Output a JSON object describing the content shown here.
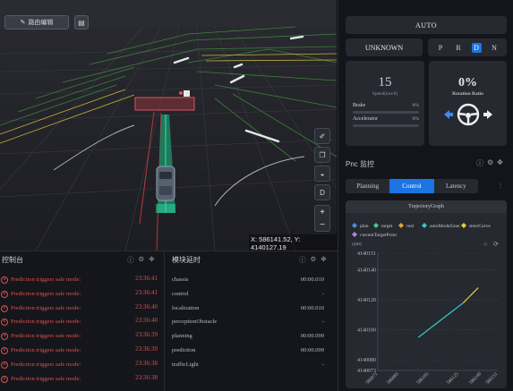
{
  "scene": {
    "route_edit_label": "路由编辑",
    "coordinates_text": "X: 586141.52, Y: 4140127.19"
  },
  "status": {
    "mode": "AUTO",
    "driving_state": "UNKNOWN",
    "gears": [
      "P",
      "R",
      "D",
      "N"
    ],
    "active_gear": "D"
  },
  "speed": {
    "value": "15",
    "label": "Speed(km/h)",
    "brake_label": "Brake",
    "brake_pct": "0%",
    "brake_fraction": 0,
    "accelerator_label": "Accelerator",
    "accelerator_pct": "0%",
    "accelerator_fraction": 0
  },
  "rotation": {
    "value": "0%",
    "label": "Rotation Ratio"
  },
  "pnc": {
    "title": "Pnc 监控",
    "tabs": [
      "Planning",
      "Control",
      "Latency"
    ],
    "active_tab": "Control"
  },
  "chart_data": {
    "type": "line",
    "title": "TrajectoryGraph",
    "ylabel": "y(m)",
    "legend_position": "top",
    "legend": [
      {
        "name": "plan",
        "color": "#4a8fe0"
      },
      {
        "name": "target",
        "color": "#3fcf8e"
      },
      {
        "name": "real",
        "color": "#e8a03a"
      },
      {
        "name": "autoModeZone",
        "color": "#37c6c6"
      },
      {
        "name": "steerCurve",
        "color": "#e6d23a"
      },
      {
        "name": "currentTargetPoint",
        "color": "#a08ae0"
      }
    ],
    "y_ticks": [
      4140151,
      4140140,
      4140120,
      4140100,
      4140080,
      4140073
    ],
    "x_ticks": [
      "586071",
      "586085",
      "586105",
      "586125",
      "586140",
      "586151"
    ],
    "ylim": [
      4140073,
      4140151
    ],
    "xlim": [
      586071,
      586151
    ],
    "grid": true,
    "series": [
      {
        "name": "plan",
        "color": "#37c6c6",
        "points": [
          [
            586098,
            4140095
          ],
          [
            586128,
            4140118
          ]
        ]
      },
      {
        "name": "steerCurve",
        "color": "#e6d23a",
        "points": [
          [
            586128,
            4140118
          ],
          [
            586138,
            4140128
          ]
        ]
      },
      {
        "name": "real",
        "color": "#e8a03a",
        "points": [
          [
            586130,
            4140120
          ],
          [
            586133,
            4140123
          ]
        ]
      }
    ]
  },
  "console": {
    "title": "控制台",
    "logs": [
      {
        "msg": "Prediction triggers safe mode:",
        "time": "23:36:41"
      },
      {
        "msg": "Prediction triggers safe mode:",
        "time": "23:36:41"
      },
      {
        "msg": "Prediction triggers safe mode:",
        "time": "23:36:40"
      },
      {
        "msg": "Prediction triggers safe mode:",
        "time": "23:36:40"
      },
      {
        "msg": "Prediction triggers safe mode:",
        "time": "23:36:39"
      },
      {
        "msg": "Prediction triggers safe mode:",
        "time": "23:36:39"
      },
      {
        "msg": "Prediction triggers safe mode:",
        "time": "23:36:38"
      },
      {
        "msg": "Prediction triggers safe mode:",
        "time": "23:36:38"
      }
    ]
  },
  "latency": {
    "title": "模块延时",
    "rows": [
      {
        "name": "chassis",
        "value": "00:00.010"
      },
      {
        "name": "control",
        "value": "-"
      },
      {
        "name": "localization",
        "value": "00:00.010"
      },
      {
        "name": "perceptionObstacle",
        "value": "-"
      },
      {
        "name": "planning",
        "value": "00:00.099"
      },
      {
        "name": "prediction",
        "value": "00:00.099"
      },
      {
        "name": "trafficLight",
        "value": "-"
      }
    ]
  }
}
